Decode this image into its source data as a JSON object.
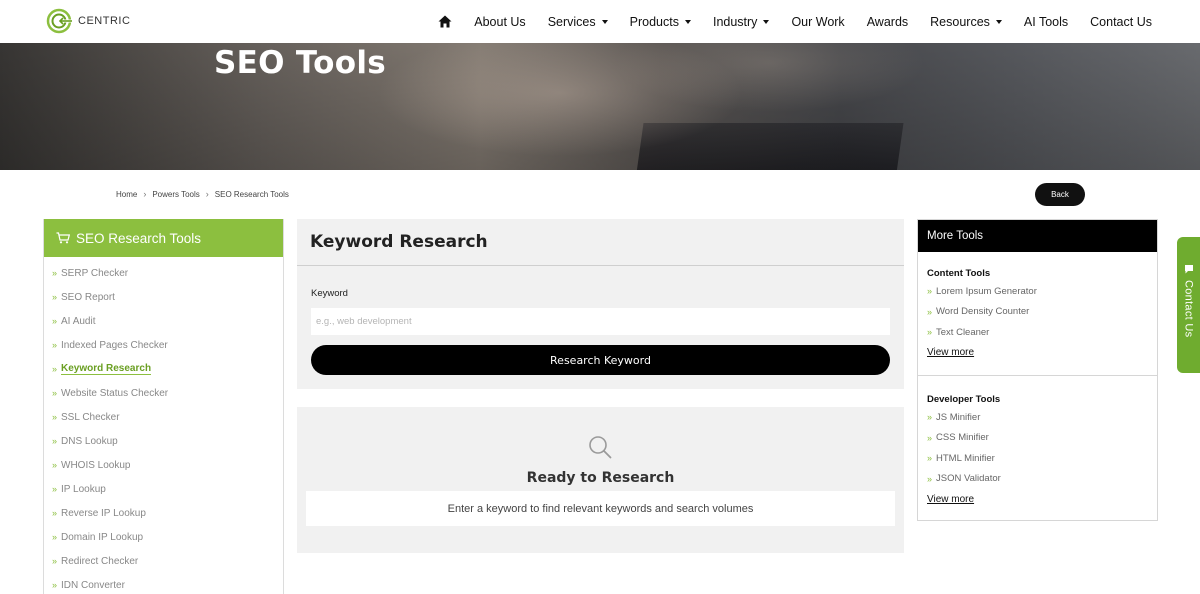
{
  "brand": {
    "name": "CENTRIC",
    "accent": "#8cbf3f",
    "dark": "#000000"
  },
  "nav": {
    "home_icon": "home-icon",
    "items": [
      {
        "label": "About Us",
        "dropdown": false
      },
      {
        "label": "Services",
        "dropdown": true
      },
      {
        "label": "Products",
        "dropdown": true
      },
      {
        "label": "Industry",
        "dropdown": true
      },
      {
        "label": "Our Work",
        "dropdown": false
      },
      {
        "label": "Awards",
        "dropdown": false
      },
      {
        "label": "Resources",
        "dropdown": true
      },
      {
        "label": "AI Tools",
        "dropdown": false
      },
      {
        "label": "Contact Us",
        "dropdown": false
      }
    ]
  },
  "hero": {
    "title": "SEO Tools"
  },
  "breadcrumb": {
    "items": [
      "Home",
      "Powers Tools",
      "SEO Research Tools"
    ]
  },
  "back_button": "Back",
  "sidebar": {
    "title": "SEO Research Tools",
    "icon": "cart-icon",
    "active": "Keyword Research",
    "items": [
      "SERP Checker",
      "SEO Report",
      "AI Audit",
      "Indexed Pages Checker",
      "Keyword Research",
      "Website Status Checker",
      "SSL Checker",
      "DNS Lookup",
      "WHOIS Lookup",
      "IP Lookup",
      "Reverse IP Lookup",
      "Domain IP Lookup",
      "Redirect Checker",
      "IDN Converter"
    ]
  },
  "main": {
    "title": "Keyword Research",
    "field_label": "Keyword",
    "input_placeholder": "e.g., web development",
    "input_value": "",
    "button_label": "Research Keyword"
  },
  "ready": {
    "icon": "search-icon",
    "title": "Ready to Research",
    "message": "Enter a keyword to find relevant keywords and search volumes"
  },
  "more_tools": {
    "title": "More Tools",
    "groups": [
      {
        "title": "Content Tools",
        "items": [
          "Lorem Ipsum Generator",
          "Word Density Counter",
          "Text Cleaner"
        ],
        "view_more": "View more"
      },
      {
        "title": "Developer Tools",
        "items": [
          "JS Minifier",
          "CSS Minifier",
          "HTML Minifier",
          "JSON Validator"
        ],
        "view_more": "View more"
      }
    ]
  },
  "contact_tab": {
    "label": "Contact Us",
    "icon": "chat-icon"
  }
}
